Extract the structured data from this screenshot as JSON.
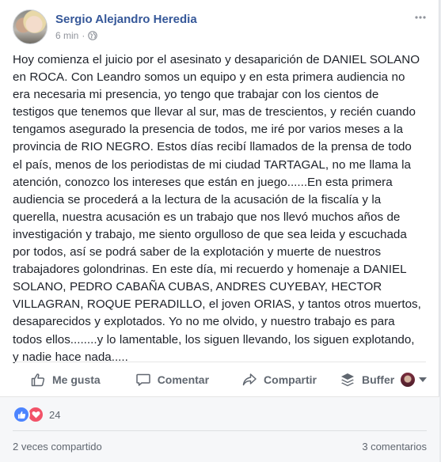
{
  "post": {
    "author": "Sergio Alejandro Heredia",
    "time": "6 min",
    "dot": "·",
    "body": "Hoy comienza el juicio por el asesinato y desaparición de DANIEL SOLANO\nen ROCA. Con Leandro somos un equipo y en esta primera audiencia no\nera necesaria mi presencia, yo tengo que trabajar con los cientos de\ntestigos que tenemos que llevar al sur, mas de trescientos, y recién cuando\ntengamos asegurado la presencia de todos, me iré por varios meses a la\nprovincia de RIO NEGRO. Estos días recibí llamados de la prensa de todo\nel país, menos de los periodistas de mi ciudad TARTAGAL, no me llama la\natención, conozco los intereses que están en juego......En esta primera\naudiencia se procederá a la lectura de la acusación de la fiscalía y la\nquerella, nuestra acusación es un trabajo que nos llevó muchos años de\ninvestigación y trabajo, me siento orgulloso de que sea leida y escuchada\npor todos, así se podrá saber de la explotación y muerte de nuestros\ntrabajadores golondrinas. En este día, mi recuerdo y homenaje a DANIEL\nSOLANO, PEDRO CABAÑA CUBAS, ANDRES CUYEBAY, HECTOR\nVILLAGRAN, ROQUE PERADILLO, el joven ORIAS, y tantos otros muertos,\ndesaparecidos y explotados. Yo no me olvido, y nuestro trabajo es para\ntodos ellos........y lo lamentable, los siguen llevando, los siguen explotando,\ny nadie hace nada....."
  },
  "actions": {
    "like": "Me gusta",
    "comment": "Comentar",
    "share": "Compartir",
    "buffer": "Buffer"
  },
  "footer": {
    "reaction_count": "24",
    "shares": "2 veces compartido",
    "comments": "3 comentarios"
  },
  "icons": {
    "privacy": "globe-icon",
    "options": "more-options-icon",
    "like": "thumbs-up-icon",
    "comment": "comment-bubble-icon",
    "share": "share-arrow-icon",
    "buffer": "buffer-stack-icon"
  },
  "colors": {
    "author_link": "#365899",
    "like_reaction": "#4c84ff",
    "love_reaction": "#f25268"
  }
}
